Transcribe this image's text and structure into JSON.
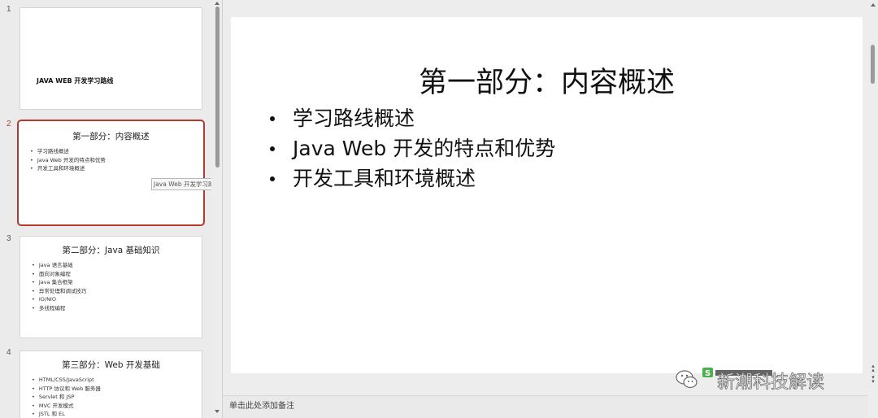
{
  "thumbnails": [
    {
      "number": "1",
      "title": "JAVA WEB 开发学习路线",
      "bullets": []
    },
    {
      "number": "2",
      "title": "第一部分：内容概述",
      "bullets": [
        "学习路线概述",
        "Java Web 开发的特点和优势",
        "开发工具和环境概述"
      ]
    },
    {
      "number": "3",
      "title": "第二部分：Java 基础知识",
      "bullets": [
        "Java 语言基础",
        "面向对象编程",
        "Java 集合框架",
        "异常处理和调试技巧",
        "IO/NIO",
        "多线程编程"
      ]
    },
    {
      "number": "4",
      "title": "第三部分：Web 开发基础",
      "bullets": [
        "HTML/CSS/JavaScript",
        "HTTP 协议和 Web 服务器",
        "Servlet 和 JSP",
        "MVC 开发模式",
        "JSTL 和 EL"
      ]
    }
  ],
  "active_slide": 2,
  "tooltip": "Java Web 开发学习路线",
  "main_slide": {
    "title": "第一部分：内容概述",
    "bullets": [
      "学习路线概述",
      "Java Web 开发的特点和优势",
      "开发工具和环境概述"
    ]
  },
  "notes_placeholder": "单击此处添加备注",
  "watermark": {
    "text": "新潮科技解读"
  },
  "colors": {
    "accent": "#b23a30",
    "wechat_green": "#4cb050"
  }
}
